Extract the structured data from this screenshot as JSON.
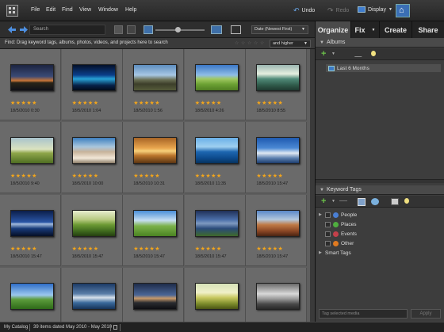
{
  "menu": {
    "items": [
      "File",
      "Edit",
      "Find",
      "View",
      "Window",
      "Help"
    ],
    "undo": "Undo",
    "redo": "Redo",
    "display": "Display"
  },
  "toolbar": {
    "search_placeholder": "Search",
    "sort": "Date (Newest First)",
    "zoom_level": 0.45
  },
  "tabs": [
    "Organize",
    "Fix",
    "Create",
    "Share"
  ],
  "active_tab": "Organize",
  "findbar": {
    "text": "Find: Drag keyword tags, albums, photos, videos, and projects here to search",
    "rating_filter": "and higher"
  },
  "photos": [
    {
      "date": "18/5/2010 0:30",
      "rating": 5,
      "scene": "night-city"
    },
    {
      "date": "18/5/2010 1:04",
      "rating": 5,
      "scene": "aurora"
    },
    {
      "date": "18/5/2010 1:56",
      "rating": 5,
      "scene": "train"
    },
    {
      "date": "18/5/2010 4:26",
      "rating": 5,
      "scene": "green-field"
    },
    {
      "date": "18/5/2010 8:55",
      "rating": 5,
      "scene": "green-lake"
    },
    {
      "date": "18/5/2010 9:40",
      "rating": 5,
      "scene": "green-tree"
    },
    {
      "date": "18/5/2010 10:00",
      "rating": 5,
      "scene": "rocks"
    },
    {
      "date": "18/5/2010 10:31",
      "rating": 5,
      "scene": "sunset-sea"
    },
    {
      "date": "18/5/2010 11:35",
      "rating": 5,
      "scene": "blue-sea"
    },
    {
      "date": "18/5/2010 15:47",
      "rating": 5,
      "scene": "frost"
    },
    {
      "date": "18/5/2010 15:47",
      "rating": 5,
      "scene": "night-lake"
    },
    {
      "date": "18/5/2010 15:47",
      "rating": 5,
      "scene": "green-hills"
    },
    {
      "date": "18/5/2010 15:47",
      "rating": 5,
      "scene": "lone-tree"
    },
    {
      "date": "18/5/2010 15:47",
      "rating": 5,
      "scene": "lake-mountains"
    },
    {
      "date": "18/5/2010 15:47",
      "rating": 5,
      "scene": "canyon"
    },
    {
      "date": "",
      "rating": 0,
      "scene": "meadow-sky"
    },
    {
      "date": "",
      "rating": 0,
      "scene": "cloud-sea"
    },
    {
      "date": "",
      "rating": 0,
      "scene": "dark-road"
    },
    {
      "date": "",
      "rating": 0,
      "scene": "yellow-field"
    },
    {
      "date": "",
      "rating": 0,
      "scene": "bw-tree"
    }
  ],
  "albums": {
    "title": "Albums",
    "items": [
      "Last 6 Months"
    ]
  },
  "keywords": {
    "title": "Keyword Tags",
    "items": [
      {
        "label": "People",
        "color": "#4a7fd4"
      },
      {
        "label": "Places",
        "color": "#4fae3f"
      },
      {
        "label": "Events",
        "color": "#c4404a"
      },
      {
        "label": "Other",
        "color": "#e07a20"
      }
    ],
    "smart_tags": "Smart Tags"
  },
  "tagbox": {
    "placeholder": "Tag selected media",
    "apply": "Apply"
  },
  "status": {
    "catalog": "My Catalog",
    "count": "39 items dated May 2010 - May 2010"
  }
}
